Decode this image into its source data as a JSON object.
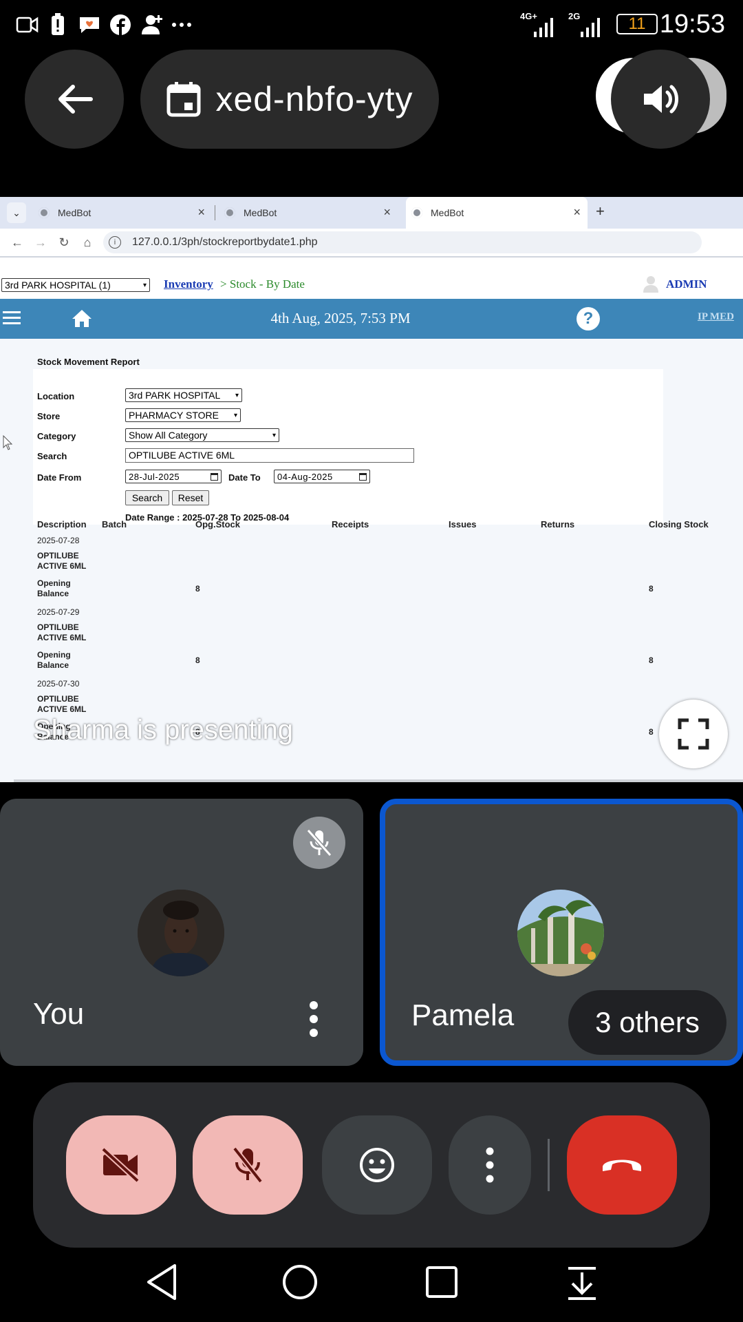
{
  "status_bar": {
    "time": "19:53",
    "battery": "11",
    "network_1": "4G+",
    "network_2": "2G",
    "icons": [
      "video-icon",
      "battery-alert-icon",
      "heart-chat-icon",
      "facebook-icon",
      "person-add-icon",
      "more-icon"
    ]
  },
  "meet": {
    "meeting_code": "xed-nbfo-yty",
    "presenting_caption": "Sharma is presenting",
    "participants": {
      "you_label": "You",
      "other_name": "Pamela",
      "others_label": "3 others"
    },
    "colors": {
      "end_call": "#d93025",
      "muted_button": "#f2b8b5",
      "active_border": "#0b57d0"
    }
  },
  "browser": {
    "tabs": [
      {
        "label": "MedBot"
      },
      {
        "label": "MedBot"
      },
      {
        "label": "MedBot"
      }
    ],
    "new_tab": "+",
    "url": "127.0.0.1/3ph/stockreportbydate1.php"
  },
  "app": {
    "hospital_select": "3rd PARK HOSPITAL (1)",
    "breadcrumb_link": "Inventory",
    "breadcrumb_rest": "> Stock - By Date",
    "user": "ADMIN",
    "datetime": "4th Aug, 2025, 7:53 PM",
    "ip_med": "IP MED",
    "report_title": "Stock Movement Report",
    "filters": {
      "location_label": "Location",
      "location_value": "3rd PARK HOSPITAL",
      "store_label": "Store",
      "store_value": "PHARMACY STORE",
      "category_label": "Category",
      "category_value": "Show All Category",
      "search_label": "Search",
      "search_value": "OPTILUBE ACTIVE 6ML",
      "date_from_label": "Date From",
      "date_from_value": "28-Jul-2025",
      "date_to_label": "Date To",
      "date_to_value": "04-Aug-2025",
      "search_button": "Search",
      "reset_button": "Reset",
      "date_range": "Date Range : 2025-07-28 To 2025-08-04"
    },
    "columns": [
      "Description",
      "Batch",
      "Opg.Stock",
      "Receipts",
      "Issues",
      "Returns",
      "Closing Stock"
    ],
    "groups": [
      {
        "date": "2025-07-28",
        "item": "OPTILUBE ACTIVE 6ML",
        "row_label": "Opening Balance",
        "opg": "8",
        "closing": "8"
      },
      {
        "date": "2025-07-29",
        "item": "OPTILUBE ACTIVE 6ML",
        "row_label": "Opening Balance",
        "opg": "8",
        "closing": "8"
      },
      {
        "date": "2025-07-30",
        "item": "OPTILUBE ACTIVE 6ML",
        "row_label": "Opening Balance",
        "opg": "8",
        "closing": "8"
      }
    ]
  }
}
